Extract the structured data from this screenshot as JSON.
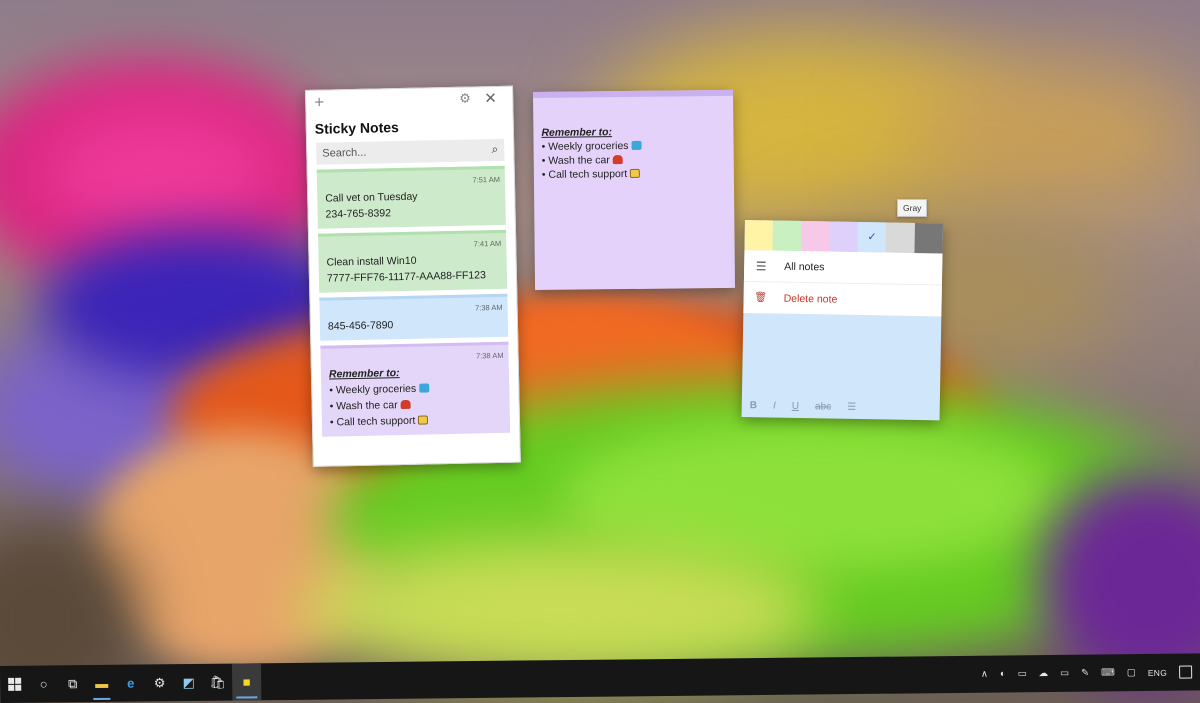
{
  "sticky_app": {
    "title": "Sticky Notes",
    "search_placeholder": "Search...",
    "notes": [
      {
        "time": "7:51 AM",
        "color": "#cdeacb",
        "lines": [
          "Call vet on Tuesday",
          "234-765-8392"
        ]
      },
      {
        "time": "7:41 AM",
        "color": "#cdeacb",
        "lines": [
          "Clean install Win10",
          "7777-FFF76-11177-AAA88-FF123"
        ]
      },
      {
        "time": "7:38 AM",
        "color": "#cfe6fb",
        "lines": [
          "845-456-7890"
        ]
      },
      {
        "time": "7:38 AM",
        "color": "#e4d6f8",
        "heading": "Remember to:",
        "items": [
          "Weekly groceries",
          "Wash the car",
          "Call tech support"
        ]
      }
    ]
  },
  "purple_note": {
    "heading": "Remember to:",
    "items": [
      "Weekly groceries",
      "Wash the car",
      "Call tech support"
    ]
  },
  "blue_note": {
    "tooltip": "Gray",
    "swatches": [
      {
        "name": "yellow",
        "color": "#fff3a5"
      },
      {
        "name": "green",
        "color": "#c8f0c0"
      },
      {
        "name": "pink",
        "color": "#f8c8e8"
      },
      {
        "name": "purple",
        "color": "#ddd0fb"
      },
      {
        "name": "blue",
        "color": "#cfe6fb",
        "selected": true
      },
      {
        "name": "gray",
        "color": "#d9d9d9"
      },
      {
        "name": "charcoal",
        "color": "#777777"
      }
    ],
    "menu": {
      "all_notes": "All notes",
      "delete_note": "Delete note"
    },
    "format": {
      "bold": "B",
      "italic": "I",
      "underline": "U",
      "strike": "abc"
    }
  },
  "taskbar": {
    "language": "ENG",
    "pinned": [
      "start",
      "cortana",
      "task-view",
      "file-explorer",
      "edge",
      "settings",
      "photos",
      "store",
      "sticky-notes"
    ]
  }
}
